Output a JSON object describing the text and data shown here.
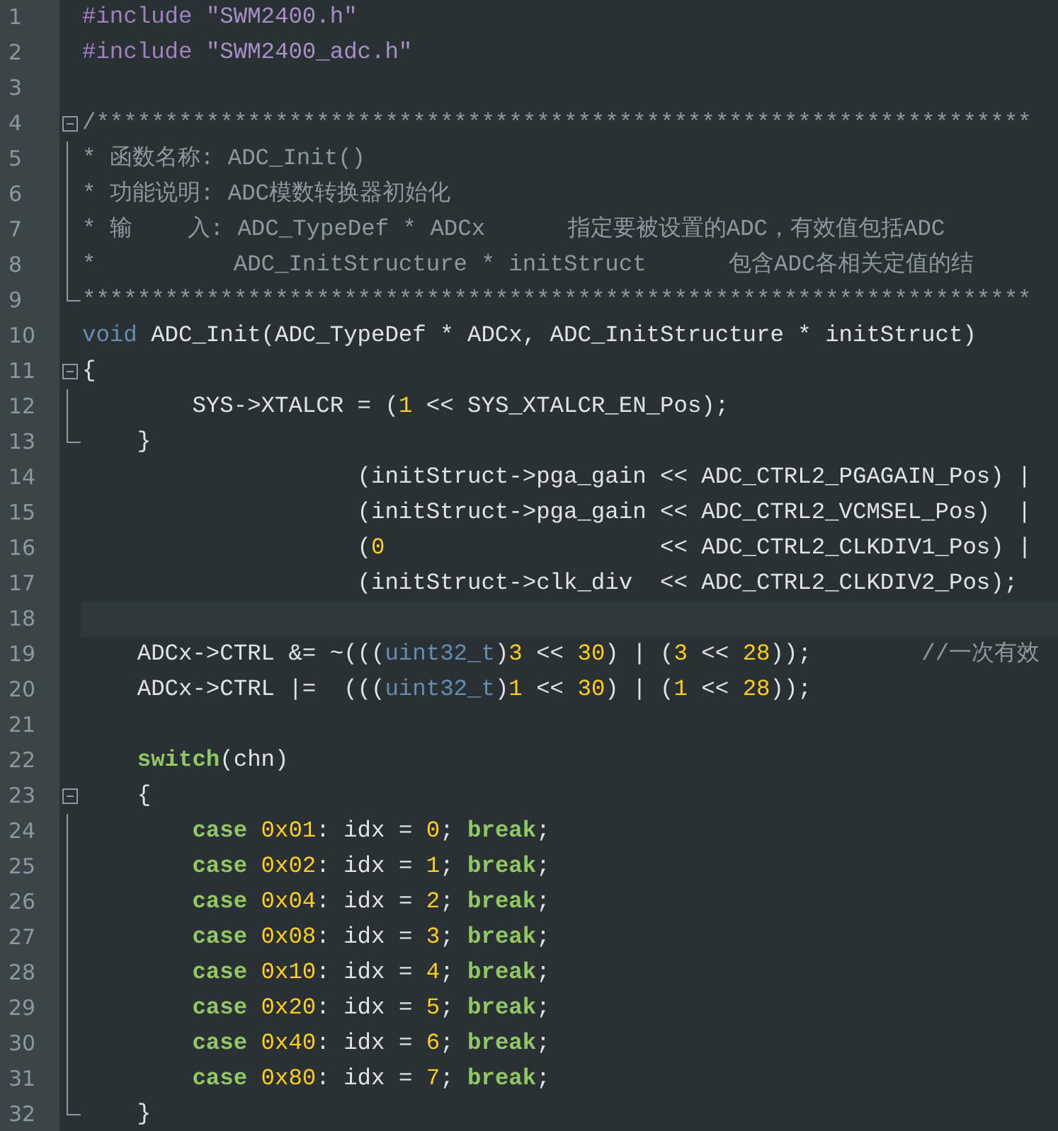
{
  "editor": {
    "lines": [
      {
        "number": "1",
        "kind": "plain",
        "current": false,
        "tokens": [
          {
            "kind": "preproc",
            "text": "#include "
          },
          {
            "kind": "string",
            "text": "\"SWM2400.h\""
          }
        ]
      },
      {
        "number": "2",
        "kind": "plain",
        "current": false,
        "tokens": [
          {
            "kind": "preproc",
            "text": "#include "
          },
          {
            "kind": "string",
            "text": "\"SWM2400_adc.h\""
          }
        ]
      },
      {
        "number": "3",
        "kind": "plain",
        "current": false
      },
      {
        "number": "4",
        "kind": "opener",
        "current": false,
        "tokens": [
          {
            "kind": "comment",
            "text": "/********************************************************************"
          }
        ]
      },
      {
        "number": "5",
        "kind": "inner",
        "current": false,
        "tokens": [
          {
            "kind": "comment",
            "text": "* 函数名称: ADC_Init()"
          }
        ]
      },
      {
        "number": "6",
        "kind": "inner",
        "current": false,
        "tokens": [
          {
            "kind": "comment",
            "text": "* 功能说明: ADC模数转换器初始化"
          }
        ]
      },
      {
        "number": "7",
        "kind": "inner",
        "current": false,
        "tokens": [
          {
            "kind": "comment",
            "text": "* 输    入: ADC_TypeDef * ADCx      指定要被设置的ADC，有效值包括ADC"
          }
        ]
      },
      {
        "number": "8",
        "kind": "inner",
        "current": false,
        "tokens": [
          {
            "kind": "comment",
            "text": "*          ADC_InitStructure * initStruct      包含ADC各相关定值的结"
          }
        ]
      },
      {
        "number": "9",
        "kind": "closer",
        "current": false,
        "tokens": [
          {
            "kind": "comment",
            "text": "*********************************************************************"
          }
        ]
      },
      {
        "number": "10",
        "kind": "plain",
        "current": false,
        "tokens": [
          {
            "kind": "type",
            "text": "void"
          },
          {
            "kind": "plain",
            "text": " ADC_Init(ADC_TypeDef * ADCx, ADC_InitStructure * initStruct)"
          }
        ]
      },
      {
        "number": "11",
        "kind": "opener",
        "current": false,
        "tokens": [
          {
            "kind": "plain",
            "text": "{"
          }
        ]
      },
      {
        "number": "12",
        "kind": "inner",
        "current": false,
        "tokens": [
          {
            "kind": "plain",
            "text": "        SYS->XTALCR = ("
          },
          {
            "kind": "number",
            "text": "1"
          },
          {
            "kind": "plain",
            "text": " << SYS_XTALCR_EN_Pos);"
          }
        ]
      },
      {
        "number": "13",
        "kind": "closer",
        "current": false,
        "tokens": [
          {
            "kind": "plain",
            "text": "    }"
          }
        ]
      },
      {
        "number": "14",
        "kind": "plain",
        "current": false,
        "tokens": [
          {
            "kind": "plain",
            "text": "                    (initStruct->pga_gain << ADC_CTRL2_PGAGAIN_Pos) |"
          }
        ]
      },
      {
        "number": "15",
        "kind": "plain",
        "current": false,
        "tokens": [
          {
            "kind": "plain",
            "text": "                    (initStruct->pga_gain << ADC_CTRL2_VCMSEL_Pos)  |"
          }
        ]
      },
      {
        "number": "16",
        "kind": "plain",
        "current": false,
        "tokens": [
          {
            "kind": "plain",
            "text": "                    ("
          },
          {
            "kind": "number",
            "text": "0"
          },
          {
            "kind": "plain",
            "text": "                    << ADC_CTRL2_CLKDIV1_Pos) |"
          }
        ]
      },
      {
        "number": "17",
        "kind": "plain",
        "current": false,
        "tokens": [
          {
            "kind": "plain",
            "text": "                    (initStruct->clk_div  << ADC_CTRL2_CLKDIV2_Pos);"
          }
        ]
      },
      {
        "number": "18",
        "kind": "plain",
        "current": true
      },
      {
        "number": "19",
        "kind": "plain",
        "current": false,
        "tokens": [
          {
            "kind": "plain",
            "text": "    ADCx->CTRL &= ~((("
          },
          {
            "kind": "type",
            "text": "uint32_t"
          },
          {
            "kind": "plain",
            "text": ")"
          },
          {
            "kind": "number",
            "text": "3"
          },
          {
            "kind": "plain",
            "text": " << "
          },
          {
            "kind": "number",
            "text": "30"
          },
          {
            "kind": "plain",
            "text": ") | ("
          },
          {
            "kind": "number",
            "text": "3"
          },
          {
            "kind": "plain",
            "text": " << "
          },
          {
            "kind": "number",
            "text": "28"
          },
          {
            "kind": "plain",
            "text": "));        "
          },
          {
            "kind": "comment",
            "text": "//一次有效"
          }
        ]
      },
      {
        "number": "20",
        "kind": "plain",
        "current": false,
        "tokens": [
          {
            "kind": "plain",
            "text": "    ADCx->CTRL |=  ((("
          },
          {
            "kind": "type",
            "text": "uint32_t"
          },
          {
            "kind": "plain",
            "text": ")"
          },
          {
            "kind": "number",
            "text": "1"
          },
          {
            "kind": "plain",
            "text": " << "
          },
          {
            "kind": "number",
            "text": "30"
          },
          {
            "kind": "plain",
            "text": ") | ("
          },
          {
            "kind": "number",
            "text": "1"
          },
          {
            "kind": "plain",
            "text": " << "
          },
          {
            "kind": "number",
            "text": "28"
          },
          {
            "kind": "plain",
            "text": "));"
          }
        ]
      },
      {
        "number": "21",
        "kind": "plain",
        "current": false
      },
      {
        "number": "22",
        "kind": "plain",
        "current": false,
        "tokens": [
          {
            "kind": "keyword",
            "text": "    switch"
          },
          {
            "kind": "plain",
            "text": "(chn)"
          }
        ]
      },
      {
        "number": "23",
        "kind": "opener",
        "current": false,
        "tokens": [
          {
            "kind": "plain",
            "text": "    {"
          }
        ]
      },
      {
        "number": "24",
        "kind": "inner",
        "current": false,
        "tokens": [
          {
            "kind": "keyword",
            "text": "        case"
          },
          {
            "kind": "number",
            "text": " 0x01"
          },
          {
            "kind": "plain",
            "text": ": idx = "
          },
          {
            "kind": "number",
            "text": "0"
          },
          {
            "kind": "plain",
            "text": "; "
          },
          {
            "kind": "keyword",
            "text": "break"
          },
          {
            "kind": "plain",
            "text": ";"
          }
        ]
      },
      {
        "number": "25",
        "kind": "inner",
        "current": false,
        "tokens": [
          {
            "kind": "keyword",
            "text": "        case"
          },
          {
            "kind": "number",
            "text": " 0x02"
          },
          {
            "kind": "plain",
            "text": ": idx = "
          },
          {
            "kind": "number",
            "text": "1"
          },
          {
            "kind": "plain",
            "text": "; "
          },
          {
            "kind": "keyword",
            "text": "break"
          },
          {
            "kind": "plain",
            "text": ";"
          }
        ]
      },
      {
        "number": "26",
        "kind": "inner",
        "current": false,
        "tokens": [
          {
            "kind": "keyword",
            "text": "        case"
          },
          {
            "kind": "number",
            "text": " 0x04"
          },
          {
            "kind": "plain",
            "text": ": idx = "
          },
          {
            "kind": "number",
            "text": "2"
          },
          {
            "kind": "plain",
            "text": "; "
          },
          {
            "kind": "keyword",
            "text": "break"
          },
          {
            "kind": "plain",
            "text": ";"
          }
        ]
      },
      {
        "number": "27",
        "kind": "inner",
        "current": false,
        "tokens": [
          {
            "kind": "keyword",
            "text": "        case"
          },
          {
            "kind": "number",
            "text": " 0x08"
          },
          {
            "kind": "plain",
            "text": ": idx = "
          },
          {
            "kind": "number",
            "text": "3"
          },
          {
            "kind": "plain",
            "text": "; "
          },
          {
            "kind": "keyword",
            "text": "break"
          },
          {
            "kind": "plain",
            "text": ";"
          }
        ]
      },
      {
        "number": "28",
        "kind": "inner",
        "current": false,
        "tokens": [
          {
            "kind": "keyword",
            "text": "        case"
          },
          {
            "kind": "number",
            "text": " 0x10"
          },
          {
            "kind": "plain",
            "text": ": idx = "
          },
          {
            "kind": "number",
            "text": "4"
          },
          {
            "kind": "plain",
            "text": "; "
          },
          {
            "kind": "keyword",
            "text": "break"
          },
          {
            "kind": "plain",
            "text": ";"
          }
        ]
      },
      {
        "number": "29",
        "kind": "inner",
        "current": false,
        "tokens": [
          {
            "kind": "keyword",
            "text": "        case"
          },
          {
            "kind": "number",
            "text": " 0x20"
          },
          {
            "kind": "plain",
            "text": ": idx = "
          },
          {
            "kind": "number",
            "text": "5"
          },
          {
            "kind": "plain",
            "text": "; "
          },
          {
            "kind": "keyword",
            "text": "break"
          },
          {
            "kind": "plain",
            "text": ";"
          }
        ]
      },
      {
        "number": "30",
        "kind": "inner",
        "current": false,
        "tokens": [
          {
            "kind": "keyword",
            "text": "        case"
          },
          {
            "kind": "number",
            "text": " 0x40"
          },
          {
            "kind": "plain",
            "text": ": idx = "
          },
          {
            "kind": "number",
            "text": "6"
          },
          {
            "kind": "plain",
            "text": "; "
          },
          {
            "kind": "keyword",
            "text": "break"
          },
          {
            "kind": "plain",
            "text": ";"
          }
        ]
      },
      {
        "number": "31",
        "kind": "inner",
        "current": false,
        "tokens": [
          {
            "kind": "keyword",
            "text": "        case"
          },
          {
            "kind": "number",
            "text": " 0x80"
          },
          {
            "kind": "plain",
            "text": ": idx = "
          },
          {
            "kind": "number",
            "text": "7"
          },
          {
            "kind": "plain",
            "text": "; "
          },
          {
            "kind": "keyword",
            "text": "break"
          },
          {
            "kind": "plain",
            "text": ";"
          }
        ]
      },
      {
        "number": "32",
        "kind": "closer",
        "current": false,
        "tokens": [
          {
            "kind": "plain",
            "text": "    }"
          }
        ]
      }
    ]
  }
}
